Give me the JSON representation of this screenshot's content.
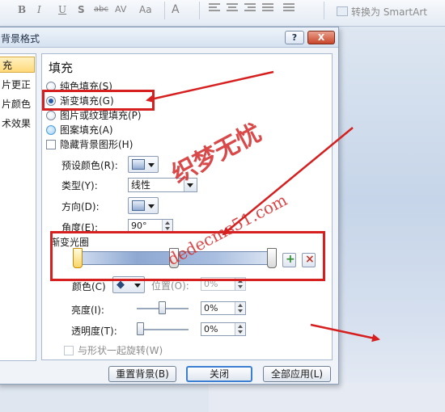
{
  "ribbon": {
    "bold": "B",
    "italic": "I",
    "underline": "U",
    "shadow": "S",
    "strikethrough": "abc",
    "spacing": "AV",
    "change_case": "Aa",
    "font_color": "A",
    "smartart_label": "转换为 SmartArt"
  },
  "dialog": {
    "title": "背景格式",
    "help_label": "?",
    "close_label": "X",
    "nav": [
      "充",
      "片更正",
      "片颜色",
      "术效果"
    ],
    "panel_title": "填充",
    "fill_options": [
      {
        "label": "纯色填充(S)",
        "selected": false
      },
      {
        "label": "渐变填充(G)",
        "selected": true
      },
      {
        "label": "图片或纹理填充(P)",
        "selected": false
      },
      {
        "label": "图案填充(A)",
        "selected": false
      }
    ],
    "hide_bg_graphics": "隐藏背景图形(H)",
    "preset_color_label": "预设颜色(R):",
    "type_label": "类型(Y):",
    "type_value": "线性",
    "direction_label": "方向(D):",
    "angle_label": "角度(E):",
    "angle_value": "90°",
    "gradient_stops_label": "渐变光圈",
    "color_label": "颜色(C)",
    "position_label": "位置(O):",
    "position_value": "0%",
    "brightness_label": "亮度(I):",
    "brightness_value": "0%",
    "transparency_label": "透明度(T):",
    "transparency_value": "0%",
    "rotate_with_shape": "与形状一起旋转(W)",
    "reset_button": "重置背景(B)",
    "close_button": "关闭",
    "apply_all_button": "全部应用(L)"
  },
  "watermark": {
    "text_cn": "织梦无忧",
    "text_url": "dedecms51.com"
  },
  "colors": {
    "annotation_red": "#d62020",
    "selected_radio": "#2a5da8"
  }
}
